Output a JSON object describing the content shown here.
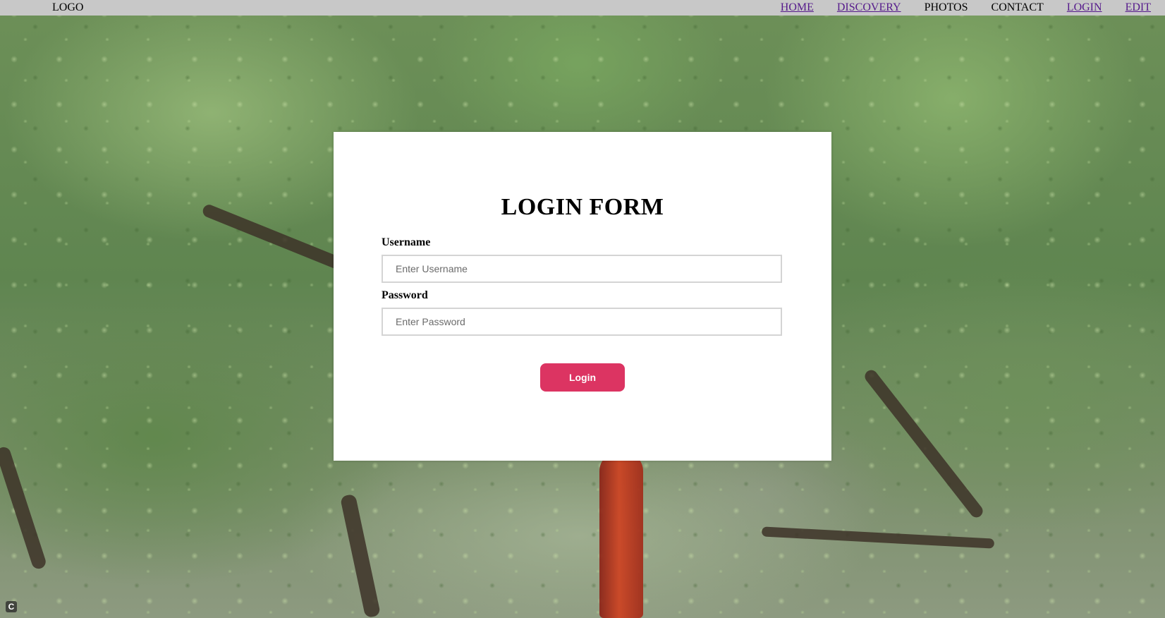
{
  "navbar": {
    "logo": "LOGO",
    "links": [
      {
        "label": "HOME",
        "style": "link"
      },
      {
        "label": "DISCOVERY",
        "style": "link"
      },
      {
        "label": "PHOTOS",
        "style": "plain"
      },
      {
        "label": "CONTACT",
        "style": "plain"
      },
      {
        "label": "LOGIN",
        "style": "link"
      },
      {
        "label": "EDIT",
        "style": "link"
      }
    ]
  },
  "login_form": {
    "title": "LOGIN FORM",
    "username_label": "Username",
    "username_placeholder": "Enter Username",
    "username_value": "",
    "password_label": "Password",
    "password_placeholder": "Enter Password",
    "password_value": "",
    "submit_label": "Login"
  },
  "corner_badge": "C",
  "colors": {
    "navbar_bg": "#c8c8c8",
    "visited_link": "#551a8b",
    "button_accent": "#dc3462",
    "card_bg": "#ffffff"
  },
  "background": {
    "icon": "forest-foliage-photo"
  }
}
